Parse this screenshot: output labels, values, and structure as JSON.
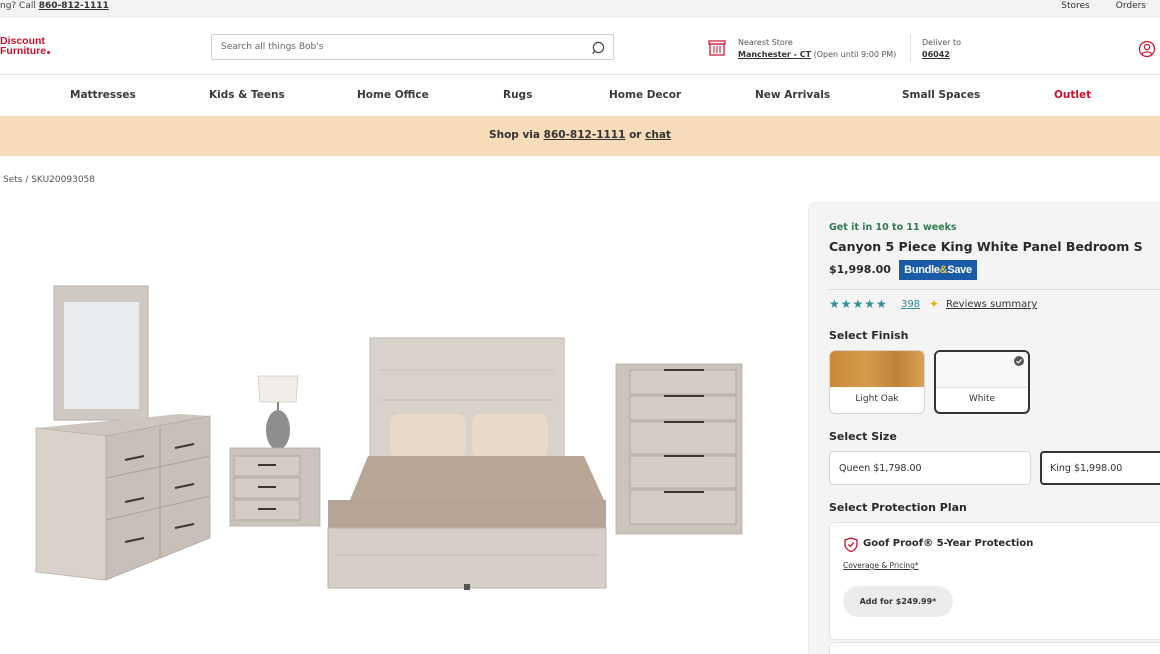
{
  "utility": {
    "call_prefix": "ng? Call",
    "phone": "860-812-1111",
    "stores": "Stores",
    "orders": "Orders"
  },
  "header": {
    "logo_line1": "Discount",
    "logo_line2": "Furniture",
    "search_placeholder": "Search all things Bob's",
    "nearest_store_label": "Nearest Store",
    "store_name": "Manchester - CT",
    "store_hours": "(Open until 9:00 PM)",
    "deliver_label": "Deliver to",
    "zip": "06042"
  },
  "nav": {
    "items": [
      "Mattresses",
      "Kids & Teens",
      "Home Office",
      "Rugs",
      "Home Decor",
      "New Arrivals",
      "Small Spaces",
      "Outlet"
    ]
  },
  "banner": {
    "prefix": "Shop via",
    "phone": "860-812-1111",
    "or": "or",
    "chat": "chat"
  },
  "breadcrumb": "Sets / SKU20093058",
  "product": {
    "delivery": "Get it in 10 to 11 weeks",
    "title": "Canyon 5 Piece King White Panel Bedroom S",
    "price": "$1,998.00",
    "bundle_part1": "Bundle",
    "bundle_amp": "&",
    "bundle_part2": "Save",
    "rating_stars": "★★★★★",
    "rating_value": 5,
    "review_count": "398",
    "reviews_summary": "Reviews summary",
    "select_finish_label": "Select Finish",
    "finishes": [
      {
        "label": "Light Oak",
        "selected": false
      },
      {
        "label": "White",
        "selected": true
      }
    ],
    "select_size_label": "Select Size",
    "sizes": [
      {
        "label": "Queen  $1,798.00",
        "selected": false
      },
      {
        "label": "King  $1,998.00",
        "selected": true
      }
    ],
    "select_protection_label": "Select Protection Plan",
    "protection": {
      "name": "Goof Proof® 5-Year Protection",
      "coverage_link": "Coverage & Pricing*",
      "add_button": "Add for $249.99*"
    }
  },
  "colors": {
    "brand_red": "#c8102e",
    "banner_bg": "#f6dcb9",
    "delivery_green": "#2e7d4f",
    "star_teal": "#2f8f9a",
    "bundle_blue": "#1b5aa7"
  }
}
